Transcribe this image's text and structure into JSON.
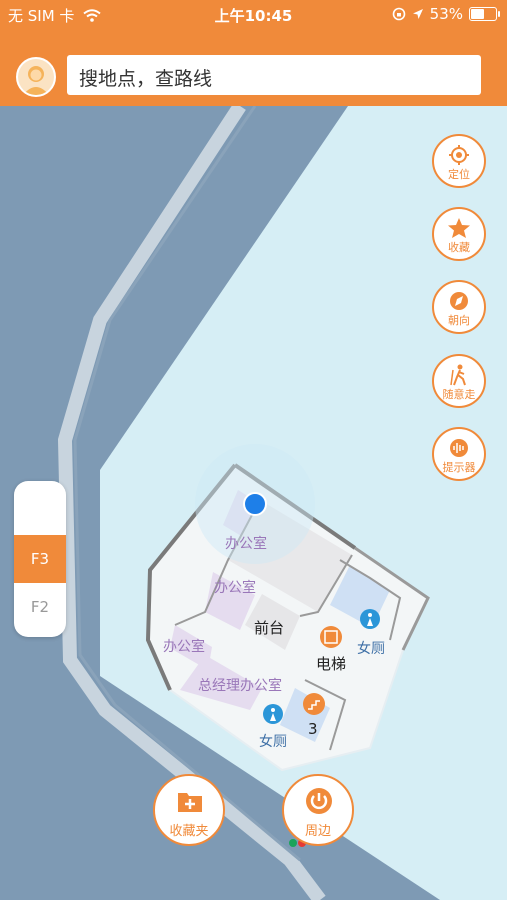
{
  "status_bar": {
    "carrier": "无 SIM 卡",
    "time": "上午10:45",
    "battery_percent": "53%",
    "battery_level": 0.53
  },
  "search": {
    "placeholder": "搜地点，查路线"
  },
  "side_buttons": [
    {
      "label": "定位",
      "icon": "locate-icon"
    },
    {
      "label": "收藏",
      "icon": "star-icon"
    },
    {
      "label": "朝向",
      "icon": "compass-icon"
    },
    {
      "label": "随意走",
      "icon": "walk-icon"
    },
    {
      "label": "提示器",
      "icon": "sound-icon"
    }
  ],
  "floors": {
    "upper": "",
    "active": "F3",
    "lower": "F2"
  },
  "map_labels": {
    "office_1": "办公室",
    "office_2": "办公室",
    "office_3": "办公室",
    "reception": "前台",
    "elevator": "电梯",
    "wc_1": "女厕",
    "wc_2": "女厕",
    "gm_office": "总经理办公室",
    "stair_number": "3"
  },
  "bottom_buttons": {
    "favorites": "收藏夹",
    "nearby": "周边"
  },
  "colors": {
    "accent": "#f08a3a",
    "map_water": "#d6eef5",
    "map_dark": "#7e9ab4",
    "room_purple": "#e5dcef",
    "location_dot": "#1e7fe8"
  }
}
